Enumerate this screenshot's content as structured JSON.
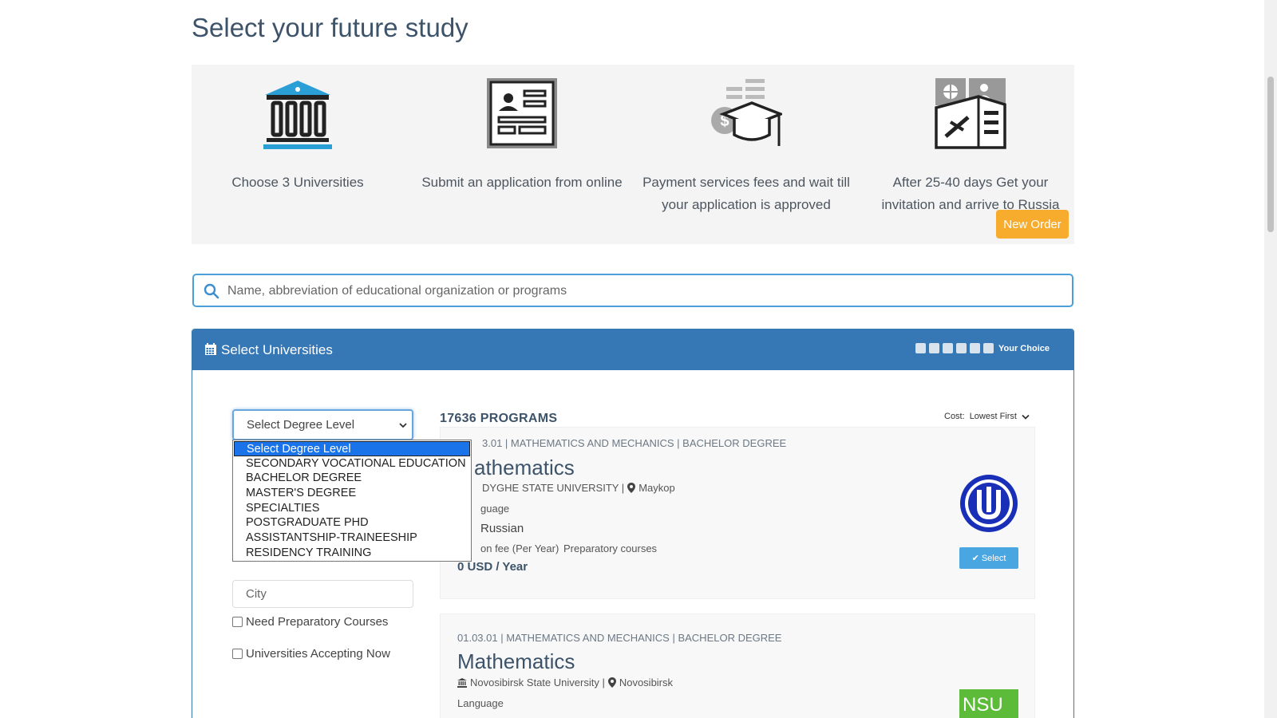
{
  "page_title": "Select your future study",
  "steps": [
    {
      "icon": "university-icon",
      "text": "Choose 3 Universities"
    },
    {
      "icon": "application-form-icon",
      "text": "Submit an application from online"
    },
    {
      "icon": "payment-graduation-icon",
      "text": "Payment services fees and wait till your application is approved"
    },
    {
      "icon": "passport-ticket-icon",
      "text": "After 25-40 days Get your invitation and arrive to Russia"
    }
  ],
  "new_order_label": "New Order",
  "search": {
    "placeholder": "Name, abbreviation of educational organization or programs"
  },
  "panel": {
    "title": "Select Universities",
    "your_choice": "Your Choice",
    "choice_slots": 6
  },
  "filters": {
    "degree_select": {
      "value": "Select Degree Level",
      "options": [
        "Select Degree Level",
        "SECONDARY VOCATIONAL EDUCATION",
        "BACHELOR DEGREE",
        "MASTER'S DEGREE",
        "SPECIALTIES",
        "POSTGRADUATE PHD",
        "ASSISTANTSHIP-TRAINEESHIP",
        "RESIDENCY TRAINING"
      ]
    },
    "city_placeholder": "City",
    "need_preparatory": "Need Preparatory Courses",
    "accepting_now": "Universities Accepting Now"
  },
  "results": {
    "count": "17636 PROGRAMS",
    "sort_label": "Cost:",
    "sort_value": "Lowest First"
  },
  "programs": [
    {
      "code": "3.01 | MATHEMATICS AND MECHANICS | BACHELOR DEGREE",
      "name": "athematics",
      "university": "DYGHE STATE UNIVERSITY |",
      "city": "Maykop",
      "language_label": "guage",
      "language": "Russian",
      "fee_label": "on fee (Per Year)",
      "prep_label": "Preparatory courses",
      "fee": "0 USD / Year",
      "select_label": "Select",
      "logo_color": "#1a2fb8"
    },
    {
      "code": "01.03.01 | MATHEMATICS AND MECHANICS | BACHELOR DEGREE",
      "name": "Mathematics",
      "university": "Novosibirsk State University |",
      "city": "Novosibirsk",
      "language_label": "Language",
      "logo_text": "NSU",
      "logo_color": "#5dbb3a"
    }
  ],
  "colors": {
    "accent": "#3677b5",
    "new_order": "#f7ac2d",
    "select_button": "#4aa6e0",
    "search_border": "#4a9fd8"
  }
}
